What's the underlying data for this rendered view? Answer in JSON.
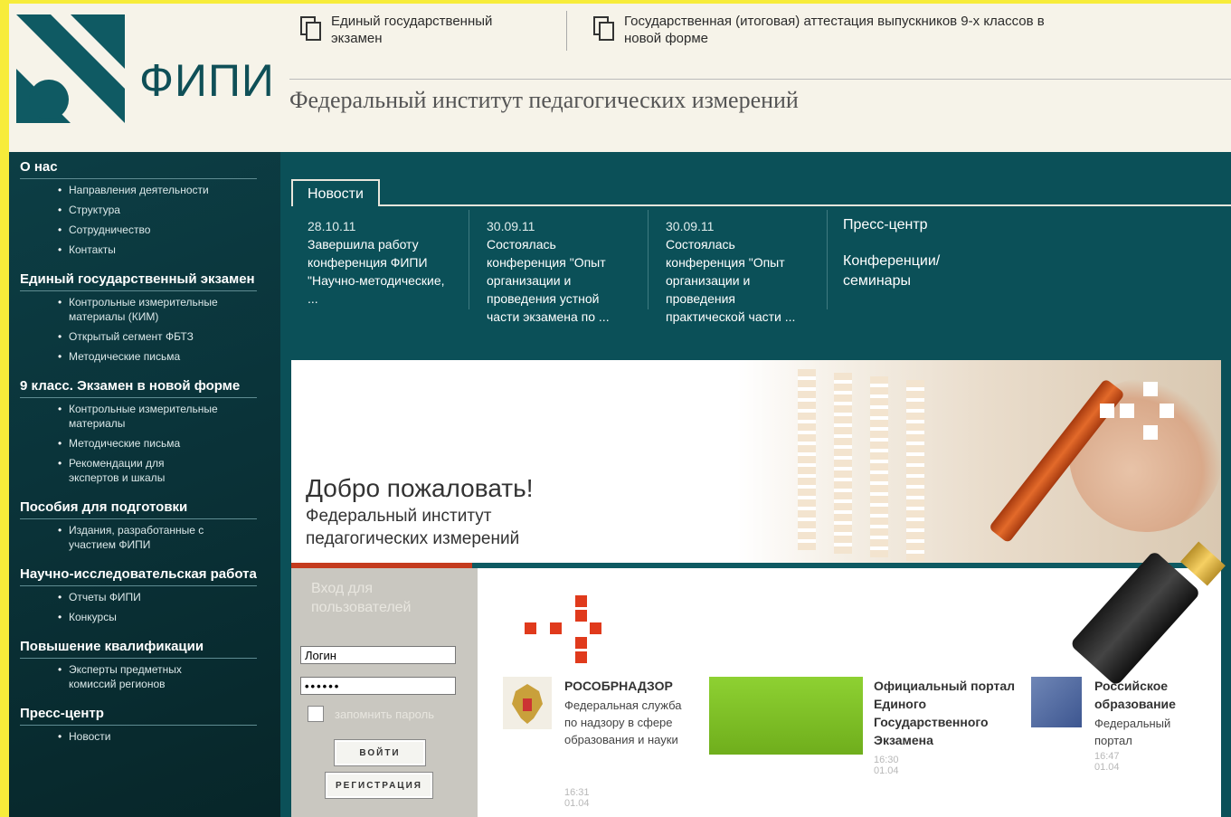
{
  "header": {
    "logo_text": "ФИПИ",
    "links": [
      {
        "label": "Единый государственный экзамен"
      },
      {
        "label": "Государственная (итоговая) аттестация выпускников 9-х классов в новой форме"
      }
    ],
    "site_name": "Федеральный институт педагогических измерений"
  },
  "sidebar": {
    "sections": [
      {
        "title": "О нас",
        "items": [
          "Направления деятельности",
          "Структура",
          "Сотрудничество",
          "Контакты"
        ]
      },
      {
        "title": "Единый государственный экзамен",
        "items": [
          "Контрольные измерительные материалы (КИМ)",
          "Открытый сегмент ФБТЗ",
          "Методические письма"
        ]
      },
      {
        "title": "9 класс. Экзамен в новой форме",
        "items": [
          "Контрольные измерительные материалы",
          "Методические письма",
          "Рекомендации для экспертов и шкалы"
        ]
      },
      {
        "title": "Пособия для подготовки",
        "items": [
          "Издания, разработанные с участием ФИПИ"
        ]
      },
      {
        "title": "Научно-исследовательская работа",
        "items": [
          "Отчеты ФИПИ",
          "Конкурсы"
        ]
      },
      {
        "title": "Повышение квалификации",
        "items": [
          "Эксперты предметных комиссий регионов"
        ]
      },
      {
        "title": "Пресс-центр",
        "items": [
          "Новости"
        ]
      }
    ]
  },
  "news": {
    "tab_label": "Новости",
    "items": [
      {
        "date": "28.10.11",
        "text": "Завершила работу конференция ФИПИ \"Научно-методические, ..."
      },
      {
        "date": "30.09.11",
        "text": "Состоялась конференция \"Опыт организации и проведения устной части экзамена по ..."
      },
      {
        "date": "30.09.11",
        "text": "Состоялась конференция \"Опыт организации и проведения практической части ..."
      }
    ],
    "press_links": [
      "Пресс-центр",
      "Конференции/ семинары"
    ]
  },
  "banner": {
    "welcome": "Добро пожаловать!",
    "subtitle": "Федеральный институт педагогических измерений"
  },
  "login": {
    "title": "Вход для пользователей",
    "login_value": "Логин",
    "password_value": "••••••",
    "remember_label": "запомнить пароль",
    "login_button": "ВОЙТИ",
    "register_button": "РЕГИСТРАЦИЯ"
  },
  "cards": [
    {
      "title": "РОСОБРНАДЗОР",
      "desc": "Федеральная служба по надзору в сфере образования и науки",
      "time": "16:31 01.04"
    },
    {
      "title": "Официальный портал Единого Государственного Экзамена",
      "desc": "",
      "time": "16:30 01.04"
    },
    {
      "title": "Российское образование",
      "desc": "Федеральный портал",
      "time": "16:47 01.04"
    }
  ],
  "colors": {
    "teal": "#0b5058",
    "accent_red": "#e03a1c",
    "green_block": "#7bbf24"
  }
}
